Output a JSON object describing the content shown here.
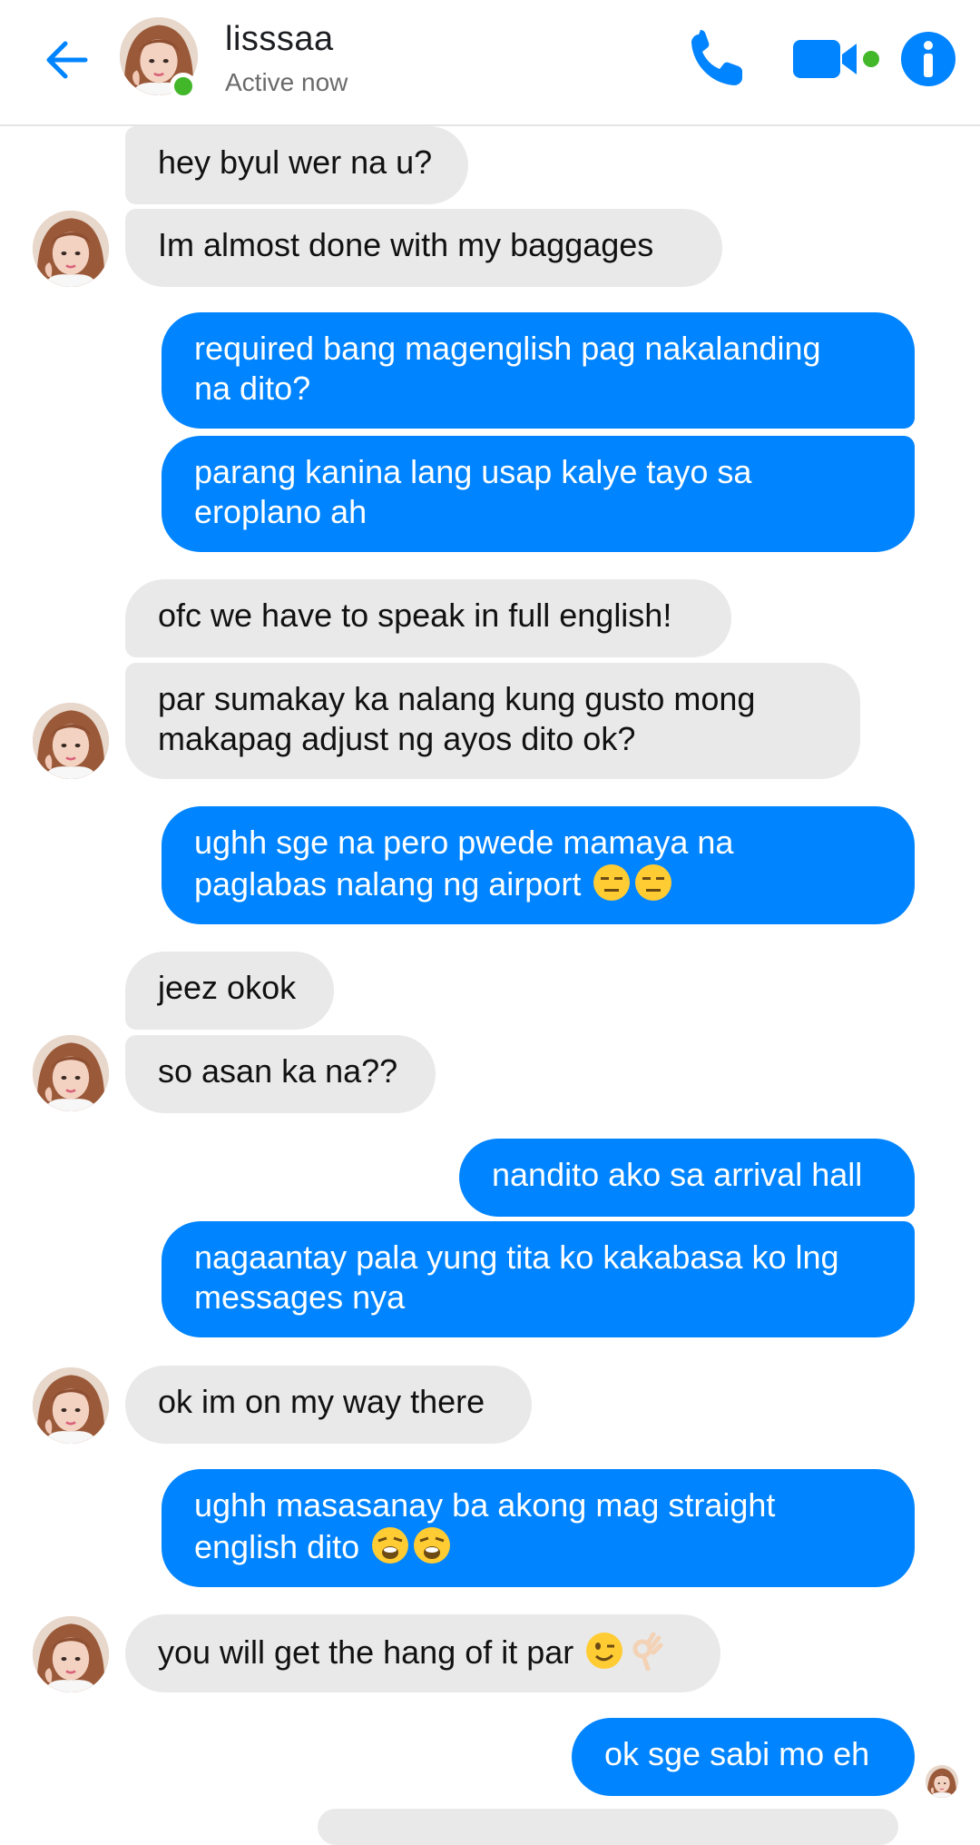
{
  "header": {
    "contact_name": "lisssaa",
    "status": "Active now",
    "accent": "#0084ff",
    "online_color": "#42b72a",
    "icons": [
      "back-arrow-icon",
      "phone-icon",
      "video-camera-icon",
      "info-icon"
    ]
  },
  "messages": [
    {
      "from": "them",
      "text": "hey byul wer na u?"
    },
    {
      "from": "them",
      "text": "Im almost done with my baggages"
    },
    {
      "from": "me",
      "lines": [
        "required bang magenglish pag nakalanding",
        "na dito?"
      ]
    },
    {
      "from": "me",
      "lines": [
        "parang kanina lang usap kalye tayo sa",
        "eroplano ah"
      ]
    },
    {
      "from": "them",
      "text": "ofc we have to speak in full english!"
    },
    {
      "from": "them",
      "lines": [
        "par sumakay ka nalang kung gusto mong",
        "makapag adjust ng ayos dito ok?"
      ]
    },
    {
      "from": "me",
      "lines": [
        "ughh sge na pero pwede mamaya na",
        "paglabas nalang ng airport"
      ],
      "emojis": [
        "expressionless-face",
        "expressionless-face"
      ]
    },
    {
      "from": "them",
      "text": "jeez okok"
    },
    {
      "from": "them",
      "text": "so asan ka na??"
    },
    {
      "from": "me",
      "text": "nandito ako sa arrival hall"
    },
    {
      "from": "me",
      "lines": [
        "nagaantay pala yung tita ko kakabasa ko lng",
        "messages nya"
      ]
    },
    {
      "from": "them",
      "text": "ok im on my way there"
    },
    {
      "from": "me",
      "lines": [
        "ughh masasanay ba akong mag straight",
        "english dito"
      ],
      "emojis": [
        "weary-face",
        "weary-face"
      ]
    },
    {
      "from": "them",
      "text": "you will get the hang of it par",
      "emojis": [
        "winking-face",
        "ok-hand"
      ]
    },
    {
      "from": "me",
      "text": "ok sge sabi mo eh"
    }
  ]
}
